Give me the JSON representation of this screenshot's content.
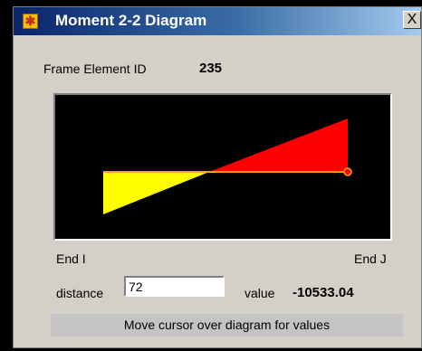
{
  "window": {
    "title": "Moment 2-2 Diagram",
    "close_label": "X"
  },
  "frame": {
    "label": "Frame Element ID",
    "id": "235"
  },
  "diagram": {
    "end_i_label": "End I",
    "end_j_label": "End J",
    "positive_color": "#ff0000",
    "negative_color": "#ffff00",
    "axis_color": "#ffa500",
    "background": "#000000"
  },
  "cursor": {
    "distance_label": "distance",
    "distance_value": "72",
    "value_label": "value",
    "value": "-10533.04"
  },
  "status": {
    "message": "Move cursor over diagram for values"
  }
}
